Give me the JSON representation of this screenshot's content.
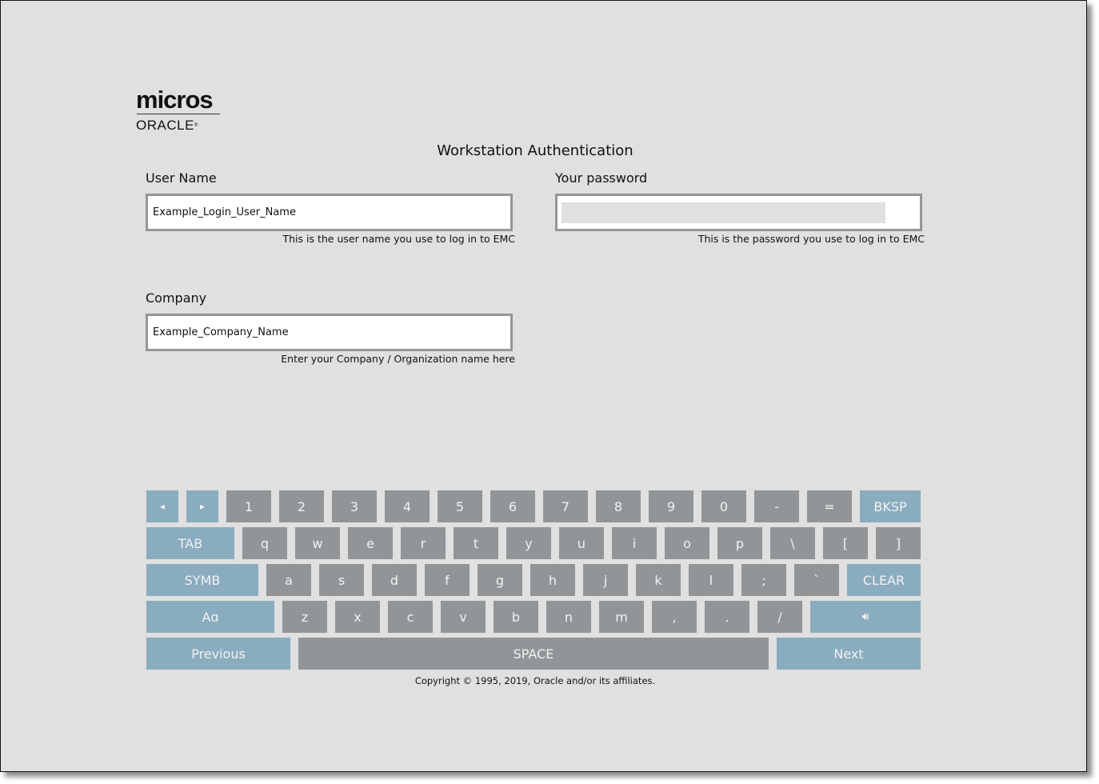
{
  "logo": {
    "brand": "micros",
    "company": "ORACLE",
    "registered": "®"
  },
  "title": "Workstation Authentication",
  "fields": {
    "username": {
      "label": "User Name",
      "value": "Example_Login_User_Name",
      "hint": "This is the user name you use to log in to EMC"
    },
    "password": {
      "label": "Your password",
      "value": "",
      "hint": "This is the password you use to log in to EMC"
    },
    "company": {
      "label": "Company",
      "value": "Example_Company_Name",
      "hint": "Enter your Company / Organization name here"
    }
  },
  "keyboard": {
    "colors": {
      "key": "#929597",
      "function_key": "#8aacbf",
      "text": "#f2f2f2"
    },
    "rows": [
      [
        {
          "label": "◂",
          "icon": "arrow-left-icon",
          "fn": true
        },
        {
          "label": "▸",
          "icon": "arrow-right-icon",
          "fn": true
        },
        {
          "label": "1"
        },
        {
          "label": "2"
        },
        {
          "label": "3"
        },
        {
          "label": "4"
        },
        {
          "label": "5"
        },
        {
          "label": "6"
        },
        {
          "label": "7"
        },
        {
          "label": "8"
        },
        {
          "label": "9"
        },
        {
          "label": "0"
        },
        {
          "label": "-"
        },
        {
          "label": "="
        },
        {
          "label": "BKSP",
          "fn": true
        }
      ],
      [
        {
          "label": "TAB",
          "fn": true
        },
        {
          "label": "q"
        },
        {
          "label": "w"
        },
        {
          "label": "e"
        },
        {
          "label": "r"
        },
        {
          "label": "t"
        },
        {
          "label": "y"
        },
        {
          "label": "u"
        },
        {
          "label": "i"
        },
        {
          "label": "o"
        },
        {
          "label": "p"
        },
        {
          "label": "\\"
        },
        {
          "label": "["
        },
        {
          "label": "]"
        }
      ],
      [
        {
          "label": "SYMB",
          "fn": true
        },
        {
          "label": "a"
        },
        {
          "label": "s"
        },
        {
          "label": "d"
        },
        {
          "label": "f"
        },
        {
          "label": "g"
        },
        {
          "label": "h"
        },
        {
          "label": "j"
        },
        {
          "label": "k"
        },
        {
          "label": "l"
        },
        {
          "label": ";"
        },
        {
          "label": "`"
        },
        {
          "label": "CLEAR",
          "fn": true
        }
      ],
      [
        {
          "label": "Aɑ",
          "icon": "case-toggle-icon",
          "fn": true
        },
        {
          "label": "z"
        },
        {
          "label": "x"
        },
        {
          "label": "c"
        },
        {
          "label": "v"
        },
        {
          "label": "b"
        },
        {
          "label": "n"
        },
        {
          "label": "m"
        },
        {
          "label": ","
        },
        {
          "label": "."
        },
        {
          "label": "/"
        },
        {
          "label": "🔊︎",
          "icon": "speaker-icon",
          "fn": true
        }
      ],
      [
        {
          "label": "Previous",
          "fn": true
        },
        {
          "label": "SPACE"
        },
        {
          "label": "Next",
          "fn": true
        }
      ]
    ]
  },
  "copyright": "Copyright © 1995, 2019, Oracle and/or its affiliates."
}
